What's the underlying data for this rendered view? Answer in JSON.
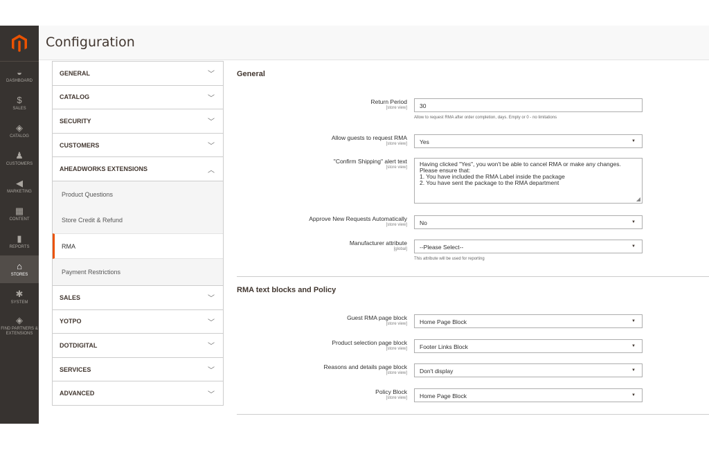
{
  "nav": {
    "items": [
      {
        "label": "DASHBOARD",
        "icon": "dashboard-icon",
        "glyph": "◒"
      },
      {
        "label": "SALES",
        "icon": "dollar-icon",
        "glyph": "$"
      },
      {
        "label": "CATALOG",
        "icon": "cube-icon",
        "glyph": "◈"
      },
      {
        "label": "CUSTOMERS",
        "icon": "person-icon",
        "glyph": "♟"
      },
      {
        "label": "MARKETING",
        "icon": "megaphone-icon",
        "glyph": "◀"
      },
      {
        "label": "CONTENT",
        "icon": "layout-icon",
        "glyph": "▦"
      },
      {
        "label": "REPORTS",
        "icon": "bar-chart-icon",
        "glyph": "▮"
      },
      {
        "label": "STORES",
        "icon": "store-icon",
        "glyph": "⌂"
      },
      {
        "label": "SYSTEM",
        "icon": "gear-icon",
        "glyph": "✱"
      },
      {
        "label": "FIND PARTNERS & EXTENSIONS",
        "icon": "box-icon",
        "glyph": "◈"
      }
    ]
  },
  "header": {
    "title": "Configuration"
  },
  "tabs": {
    "general": "GENERAL",
    "catalog": "CATALOG",
    "security": "SECURITY",
    "customers": "CUSTOMERS",
    "aheadworks": "AHEADWORKS EXTENSIONS",
    "sub": [
      "Product Questions",
      "Store Credit & Refund",
      "RMA",
      "Payment Restrictions"
    ],
    "sales": "SALES",
    "yotpo": "YOTPO",
    "dotdigital": "DOTDIGITAL",
    "services": "SERVICES",
    "advanced": "ADVANCED"
  },
  "general": {
    "title": "General",
    "return_period": {
      "label": "Return Period",
      "scope": "[store view]",
      "value": "30",
      "note": "Allow to request RMA after order completion, days. Empty or 0 - no limitations"
    },
    "allow_guests": {
      "label": "Allow guests to request RMA",
      "scope": "[store view]",
      "value": "Yes"
    },
    "confirm_shipping": {
      "label": "\"Confirm Shipping\" alert text",
      "scope": "[store view]",
      "value": "Having clicked \"Yes\", you won't be able to cancel RMA or make any changes.\nPlease ensure that:\n1. You have included the RMA Label inside the package\n2. You have sent the package to the RMA department"
    },
    "approve": {
      "label": "Approve New Requests Automatically",
      "scope": "[store view]",
      "value": "No"
    },
    "manufacturer": {
      "label": "Manufacturer attribute",
      "scope": "[global]",
      "value": "--Please Select--",
      "note": "This attribute will be used for reporting"
    }
  },
  "blocks": {
    "title": "RMA text blocks and Policy",
    "guest": {
      "label": "Guest RMA page block",
      "scope": "[store view]",
      "value": "Home Page Block"
    },
    "product": {
      "label": "Product selection page block",
      "scope": "[store view]",
      "value": "Footer Links Block"
    },
    "reasons": {
      "label": "Reasons and details page block",
      "scope": "[store view]",
      "value": "Don't display"
    },
    "policy": {
      "label": "Policy Block",
      "scope": "[store view]",
      "value": "Home Page Block"
    }
  }
}
